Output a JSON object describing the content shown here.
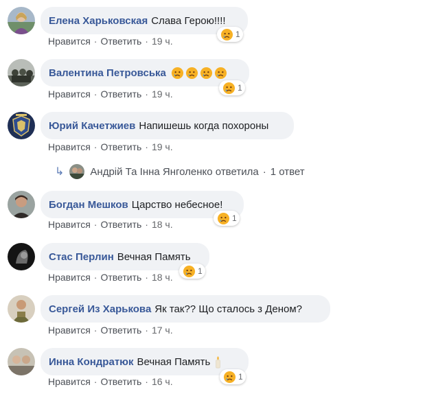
{
  "comments": [
    {
      "author": "Елена Харьковская",
      "text": "Слава Герою!!!!",
      "emojis": [],
      "reaction": {
        "icon": "sad-face-icon",
        "count": "1"
      },
      "like": "Нравится",
      "reply": "Ответить",
      "time": "19 ч."
    },
    {
      "author": "Валентина Петровська",
      "text": "",
      "emojis": [
        "sad-face-icon",
        "sad-face-icon",
        "sad-face-icon",
        "sad-face-icon"
      ],
      "reaction": {
        "icon": "sad-face-icon",
        "count": "1"
      },
      "like": "Нравится",
      "reply": "Ответить",
      "time": "19 ч."
    },
    {
      "author": "Юрий Качетжиев",
      "text": "Напишешь когда похороны",
      "emojis": [],
      "reaction": null,
      "like": "Нравится",
      "reply": "Ответить",
      "time": "19 ч."
    },
    {
      "author": "Богдан Мешков",
      "text": "Царство небесное!",
      "emojis": [],
      "reaction": {
        "icon": "sad-face-icon",
        "count": "1"
      },
      "like": "Нравится",
      "reply": "Ответить",
      "time": "18 ч."
    },
    {
      "author": "Стас Перлин",
      "text": "Вечная Память",
      "emojis": [],
      "reaction": {
        "icon": "sad-face-icon",
        "count": "1"
      },
      "like": "Нравится",
      "reply": "Ответить",
      "time": "18 ч."
    },
    {
      "author": "Сергей Из Харькова",
      "text": "Як так?? Що сталось з Деном?",
      "emojis": [],
      "reaction": null,
      "like": "Нравится",
      "reply": "Ответить",
      "time": "17 ч."
    },
    {
      "author": "Инна Кондратюк",
      "text": "Вечная Память",
      "emojis": [
        "candle-icon"
      ],
      "reaction": {
        "icon": "sad-face-icon",
        "count": "1"
      },
      "like": "Нравится",
      "reply": "Ответить",
      "time": "16 ч."
    }
  ],
  "reply_thread": {
    "text": "Андрій Та Інна Янголенко ответила",
    "separator": "·",
    "count": "1 ответ"
  },
  "separator": "·",
  "colors": {
    "author": "#385898",
    "bubble": "#f0f2f5",
    "meta": "#65676b",
    "reaction_face": "#f7b125"
  }
}
